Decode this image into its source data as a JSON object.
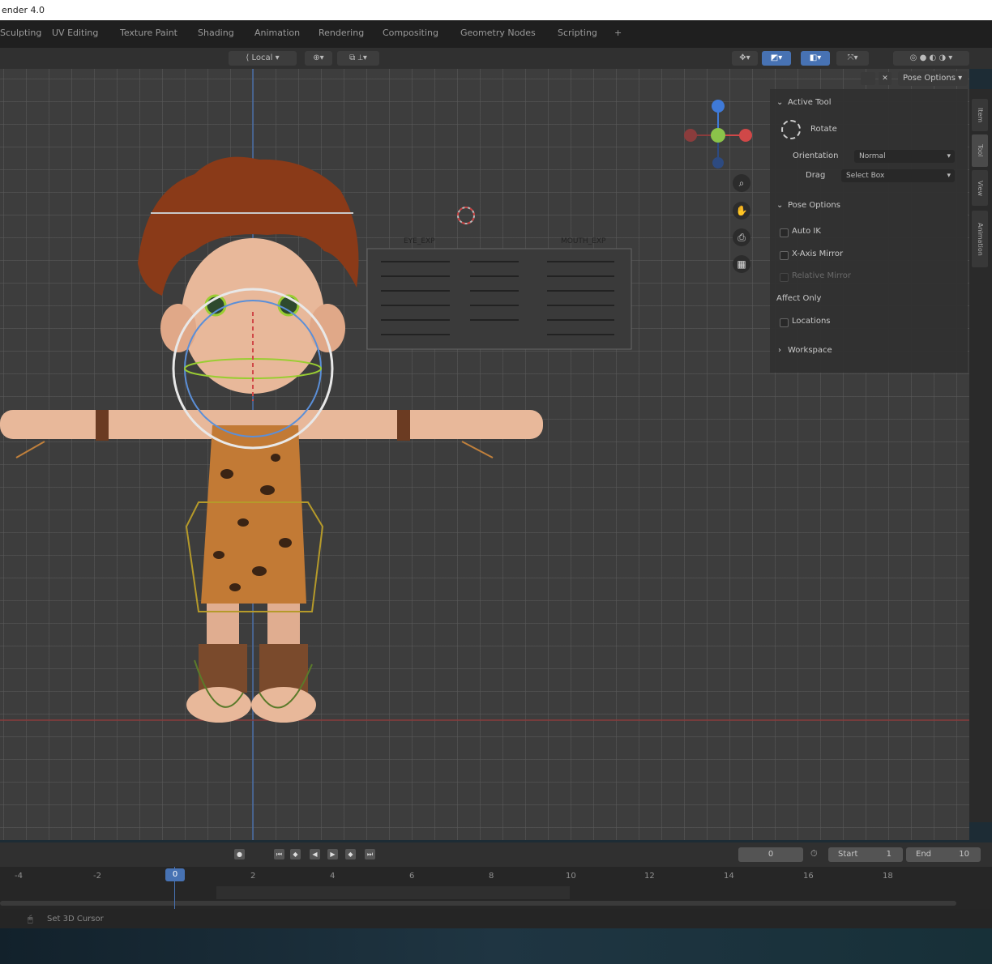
{
  "window": {
    "title": "ender 4.0"
  },
  "workspace_tabs": [
    "Sculpting",
    "UV Editing",
    "Texture Paint",
    "Shading",
    "Animation",
    "Rendering",
    "Compositing",
    "Geometry Nodes",
    "Scripting",
    "+"
  ],
  "header": {
    "transform_orientation": "Local",
    "pose_options_label": "Pose Options"
  },
  "sidebar_panel": {
    "active_tool_heading": "Active Tool",
    "tool_name": "Rotate",
    "orientation_label": "Orientation",
    "orientation_value": "Normal",
    "drag_label": "Drag",
    "drag_value": "Select Box",
    "pose_options_heading": "Pose Options",
    "auto_ik_label": "Auto IK",
    "x_axis_mirror_label": "X-Axis Mirror",
    "relative_mirror_label": "Relative Mirror",
    "affect_only_label": "Affect Only",
    "locations_label": "Locations",
    "workspace_heading": "Workspace"
  },
  "side_tabs": [
    "Item",
    "Tool",
    "View",
    "Animation"
  ],
  "face_controls": {
    "left_title": "EYE_EXP",
    "right_title": "MOUTH_EXP"
  },
  "timeline": {
    "current_frame": "0",
    "start_label": "Start",
    "start_value": "1",
    "end_label": "End",
    "end_value": "10",
    "playhead_frame": "0",
    "ticks": [
      "-4",
      "-2",
      "2",
      "4",
      "6",
      "8",
      "10",
      "12",
      "14",
      "16",
      "18"
    ]
  },
  "status": {
    "hint": "Set 3D Cursor"
  },
  "colors": {
    "accent_blue": "#4772b3",
    "axis_x": "#d04848",
    "axis_y": "#8bc34a",
    "axis_z": "#3f7ad8",
    "viewport_bg": "#3d3d3d"
  }
}
